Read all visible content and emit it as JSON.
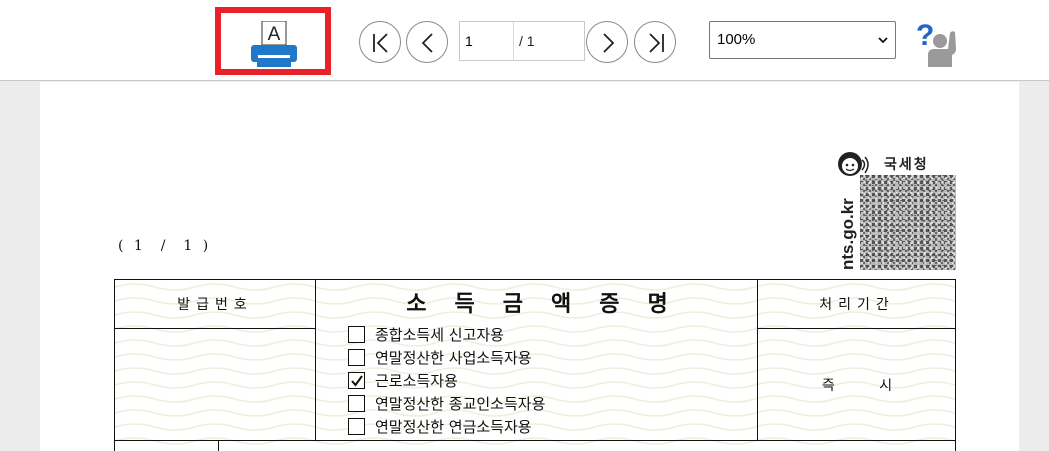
{
  "toolbar": {
    "print_icon_letter": "A",
    "page_input_value": "1",
    "page_total": "/ 1",
    "zoom": {
      "selected": "100%"
    },
    "icons": {
      "print": "print-icon",
      "first": "first-page-icon",
      "prev": "previous-page-icon",
      "next": "next-page-icon",
      "last": "last-page-icon",
      "help": "help-icon"
    }
  },
  "colors": {
    "print_highlight": "#e8212a",
    "printer_blue": "#1f78c8",
    "help_blue": "#2166c7",
    "help_gray": "#9a9a9a",
    "background": "#ececec",
    "form_wave": "#efeedd"
  },
  "document": {
    "agency_name": "국세청",
    "agency_site": "nts.go.kr",
    "page_indicator": "( 1  /  1 )",
    "form": {
      "issue_number_label": "발급번호",
      "title": "소득금액증명",
      "processing_period_label": "처리기간",
      "processing_period_value": "즉 시",
      "purposes": [
        {
          "label": "종합소득세 신고자용",
          "checked": false
        },
        {
          "label": "연말정산한 사업소득자용",
          "checked": false
        },
        {
          "label": "근로소득자용",
          "checked": true
        },
        {
          "label": "연말정산한 종교인소득자용",
          "checked": false
        },
        {
          "label": "연말정산한 연금소득자용",
          "checked": false
        }
      ]
    }
  }
}
